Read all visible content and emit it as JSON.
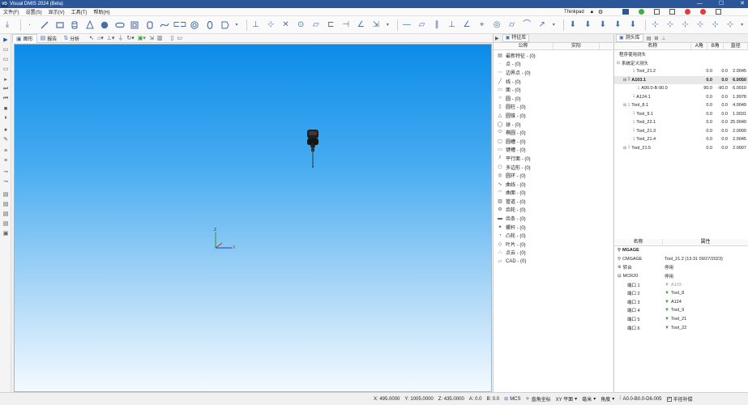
{
  "app": {
    "title": "Visual DMIS 2024 (Beta)",
    "logo": "VD",
    "window_controls": [
      "—",
      "☐",
      "✕"
    ]
  },
  "menu": {
    "items": [
      "文件(F)",
      "设置(S)",
      "显示(V)",
      "工具(T)",
      "帮助(H)"
    ],
    "user": "Thinkpad"
  },
  "viewport_tabs": {
    "graphics": "图形",
    "report": "报告",
    "analysis": "分析"
  },
  "axes": {
    "z": "Z",
    "x": "X"
  },
  "feature_panel": {
    "tab": "特征库",
    "col_name": "公称",
    "col_actual": "实际",
    "items": [
      {
        "icon": "▤",
        "label": "最新特征 - (0)"
      },
      {
        "icon": "·",
        "label": "点 - (0)"
      },
      {
        "icon": "⋯",
        "label": "边界点 - (0)"
      },
      {
        "icon": "╱",
        "label": "线 - (0)"
      },
      {
        "icon": "▭",
        "label": "面 - (0)"
      },
      {
        "icon": "○",
        "label": "圆 - (0)"
      },
      {
        "icon": "▯",
        "label": "圆柱 - (0)"
      },
      {
        "icon": "△",
        "label": "圆锥 - (0)"
      },
      {
        "icon": "◯",
        "label": "球 - (0)"
      },
      {
        "icon": "⬭",
        "label": "椭圆 - (0)"
      },
      {
        "icon": "▢",
        "label": "圆槽 - (0)"
      },
      {
        "icon": "▭",
        "label": "键槽 - (0)"
      },
      {
        "icon": "⫽",
        "label": "平行面 - (0)"
      },
      {
        "icon": "⬡",
        "label": "多边形 - (0)"
      },
      {
        "icon": "◎",
        "label": "圆环 - (0)"
      },
      {
        "icon": "∿",
        "label": "曲线 - (0)"
      },
      {
        "icon": "◠",
        "label": "曲面 - (0)"
      },
      {
        "icon": "▥",
        "label": "管道 - (0)"
      },
      {
        "icon": "⚙",
        "label": "齿轮 - (0)"
      },
      {
        "icon": "▬",
        "label": "齿条 - (0)"
      },
      {
        "icon": "✦",
        "label": "螺杆 - (0)"
      },
      {
        "icon": "◔",
        "label": "凸轮 - (0)"
      },
      {
        "icon": "◇",
        "label": "叶片 - (0)"
      },
      {
        "icon": "∴",
        "label": "点云 - (0)"
      },
      {
        "icon": "▱",
        "label": "CAD - (0)"
      }
    ]
  },
  "probe_panel": {
    "tab": "测头库",
    "col_name": "名称",
    "col_a": "A角",
    "col_b": "B角",
    "col_d": "直径",
    "group_program": "程序使用测头",
    "group_system": "系统定义测头",
    "rows": [
      {
        "name": "Tool_21.2",
        "a": "0.0",
        "b": "0.0",
        "d": "2.0045",
        "indent": 2,
        "expand": "",
        "selected": false
      },
      {
        "name": "A103.1",
        "a": "0.0",
        "b": "0.0",
        "d": "6.0050",
        "indent": 1,
        "expand": "⊟",
        "selected": true
      },
      {
        "name": "A90.0-B-90.0",
        "a": "90.0",
        "b": "-90.0",
        "d": "6.0010",
        "indent": 3,
        "expand": "",
        "selected": false
      },
      {
        "name": "A124.1",
        "a": "0.0",
        "b": "0.0",
        "d": "1.9978",
        "indent": 2,
        "expand": "",
        "selected": false
      },
      {
        "name": "Tool_8.1",
        "a": "0.0",
        "b": "0.0",
        "d": "4.0049",
        "indent": 1,
        "expand": "⊞",
        "selected": false
      },
      {
        "name": "Tool_9.1",
        "a": "0.0",
        "b": "0.0",
        "d": "1.0031",
        "indent": 2,
        "expand": "",
        "selected": false
      },
      {
        "name": "Tool_22.1",
        "a": "0.0",
        "b": "0.0",
        "d": "25.0040",
        "indent": 2,
        "expand": "",
        "selected": false
      },
      {
        "name": "Tool_21.3",
        "a": "0.0",
        "b": "0.0",
        "d": "2.0000",
        "indent": 2,
        "expand": "",
        "selected": false
      },
      {
        "name": "Tool_21.4",
        "a": "0.0",
        "b": "0.0",
        "d": "2.0045",
        "indent": 2,
        "expand": "",
        "selected": false
      },
      {
        "name": "Tool_21.5",
        "a": "0.0",
        "b": "0.0",
        "d": "2.0007",
        "indent": 1,
        "expand": "⊞",
        "selected": false
      }
    ],
    "prop_col_name": "名称",
    "prop_col_value": "属性",
    "props": [
      {
        "name": "MGAGE",
        "value": "",
        "bold": true,
        "indent": 0,
        "icon": "⚲"
      },
      {
        "name": "CMGAGE",
        "value": "Tool_21.2 (13:31 09/27/2023)",
        "bold": false,
        "indent": 0,
        "icon": "⚲"
      },
      {
        "name": "转台",
        "value": "停用",
        "bold": false,
        "indent": 0,
        "icon": "⊛"
      },
      {
        "name": "MCR20",
        "value": "停用",
        "bold": false,
        "indent": 0,
        "icon": "⊟"
      },
      {
        "name": "端口 1",
        "value": "A103",
        "bold": false,
        "indent": 1,
        "icon": "",
        "gray": true
      },
      {
        "name": "端口 2",
        "value": "Tool_8",
        "bold": false,
        "indent": 1,
        "icon": ""
      },
      {
        "name": "端口 3",
        "value": "A124",
        "bold": false,
        "indent": 1,
        "icon": ""
      },
      {
        "name": "端口 4",
        "value": "Tool_9",
        "bold": false,
        "indent": 1,
        "icon": ""
      },
      {
        "name": "端口 5",
        "value": "Tool_21",
        "bold": false,
        "indent": 1,
        "icon": ""
      },
      {
        "name": "端口 6",
        "value": "Tool_22",
        "bold": false,
        "indent": 1,
        "icon": ""
      }
    ]
  },
  "status": {
    "x": "X:  495.0000",
    "y": "Y:  1005.0000",
    "z": "Z:  435.0000",
    "a": "A:  0.0",
    "b": "B:  0.0",
    "mcs": "MCS",
    "coord": "直角坐标",
    "plane": "XY 平面",
    "unit": "毫米",
    "angle": "角度",
    "probe": "A0.0-B0.0-D6.005",
    "comp": "半径补偿"
  },
  "colors": {
    "titlebar": "#2b579a",
    "viewport_top": "#0b8ce9",
    "viewport_bottom": "#f4faff"
  }
}
